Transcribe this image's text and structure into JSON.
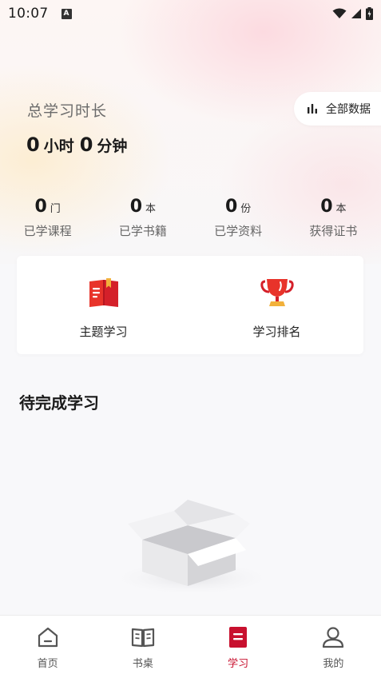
{
  "status_bar": {
    "time": "10:07",
    "notification_icon": "A"
  },
  "summary": {
    "title": "总学习时长",
    "hours": "0",
    "hours_unit": "小时",
    "minutes": "0",
    "minutes_unit": "分钟",
    "all_data_button": "全部数据"
  },
  "stats": [
    {
      "value": "0",
      "unit": "门",
      "label": "已学课程"
    },
    {
      "value": "0",
      "unit": "本",
      "label": "已学书籍"
    },
    {
      "value": "0",
      "unit": "份",
      "label": "已学资料"
    },
    {
      "value": "0",
      "unit": "本",
      "label": "获得证书"
    }
  ],
  "features": [
    {
      "label": "主题学习",
      "icon": "open-book-icon"
    },
    {
      "label": "学习排名",
      "icon": "trophy-icon"
    }
  ],
  "pending": {
    "title": "待完成学习"
  },
  "bottom_nav": [
    {
      "label": "首页",
      "icon": "home-icon",
      "active": false
    },
    {
      "label": "书桌",
      "icon": "book-icon",
      "active": false
    },
    {
      "label": "学习",
      "icon": "study-icon",
      "active": true
    },
    {
      "label": "我的",
      "icon": "profile-icon",
      "active": false
    }
  ],
  "colors": {
    "accent": "#c8102e",
    "icon_red": "#e8332a",
    "icon_gold": "#f2b13b"
  }
}
